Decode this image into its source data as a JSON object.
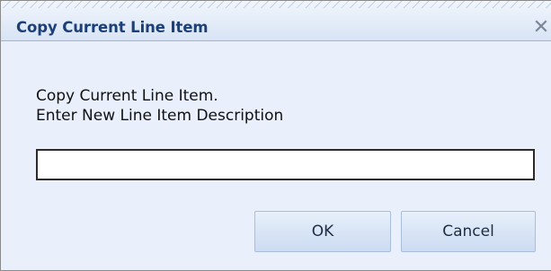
{
  "dialog": {
    "title": "Copy Current Line Item",
    "close_icon": "close-icon",
    "message_line1": "Copy Current Line Item.",
    "message_line2": "Enter New Line Item Description",
    "description_input": {
      "value": "",
      "placeholder": ""
    },
    "ok_label": "OK",
    "cancel_label": "Cancel"
  },
  "colors": {
    "title_text": "#1b3f78",
    "dialog_background": "#e9f0fb",
    "button_gradient_top": "#e8f0fb",
    "button_gradient_bottom": "#ccdcf2"
  }
}
